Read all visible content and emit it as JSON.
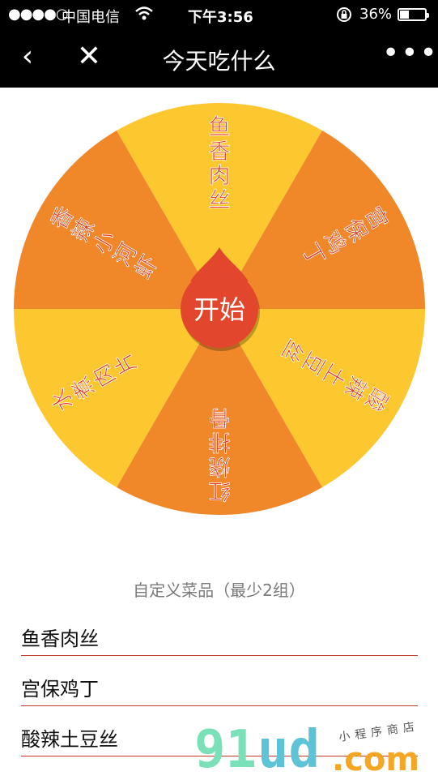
{
  "status_bar": {
    "signal": "●●●●○",
    "carrier": "中国电信",
    "wifi_icon": "wifi-icon",
    "time": "下午3:56",
    "lock_icon": "rotation-lock-icon",
    "battery_percent": "36%",
    "battery_level": 0.36
  },
  "nav": {
    "back_icon": "‹",
    "close_icon": "✕",
    "title": "今天吃什么",
    "more_icon": "•••"
  },
  "wheel": {
    "start_label": "开始",
    "colors": {
      "yellow": "#fdc82f",
      "orange": "#f0882a",
      "center": "#e2472e",
      "text": "#e0371f"
    },
    "segments": [
      {
        "label": "鱼香肉丝",
        "color": "yellow"
      },
      {
        "label": "宫保鸡丁",
        "color": "orange"
      },
      {
        "label": "酸辣土豆丝",
        "color": "yellow"
      },
      {
        "label": "红烧排骨",
        "color": "orange"
      },
      {
        "label": "水煮肉片",
        "color": "yellow"
      },
      {
        "label": "香辣小河虾",
        "color": "orange"
      }
    ]
  },
  "custom": {
    "title": "自定义菜品（最少2组）",
    "dishes": [
      "鱼香肉丝",
      "宫保鸡丁",
      "酸辣土豆丝"
    ]
  },
  "watermark": {
    "part1": "91",
    "part2": "ud",
    "part3": ".com",
    "tagline": "小程序商店"
  }
}
